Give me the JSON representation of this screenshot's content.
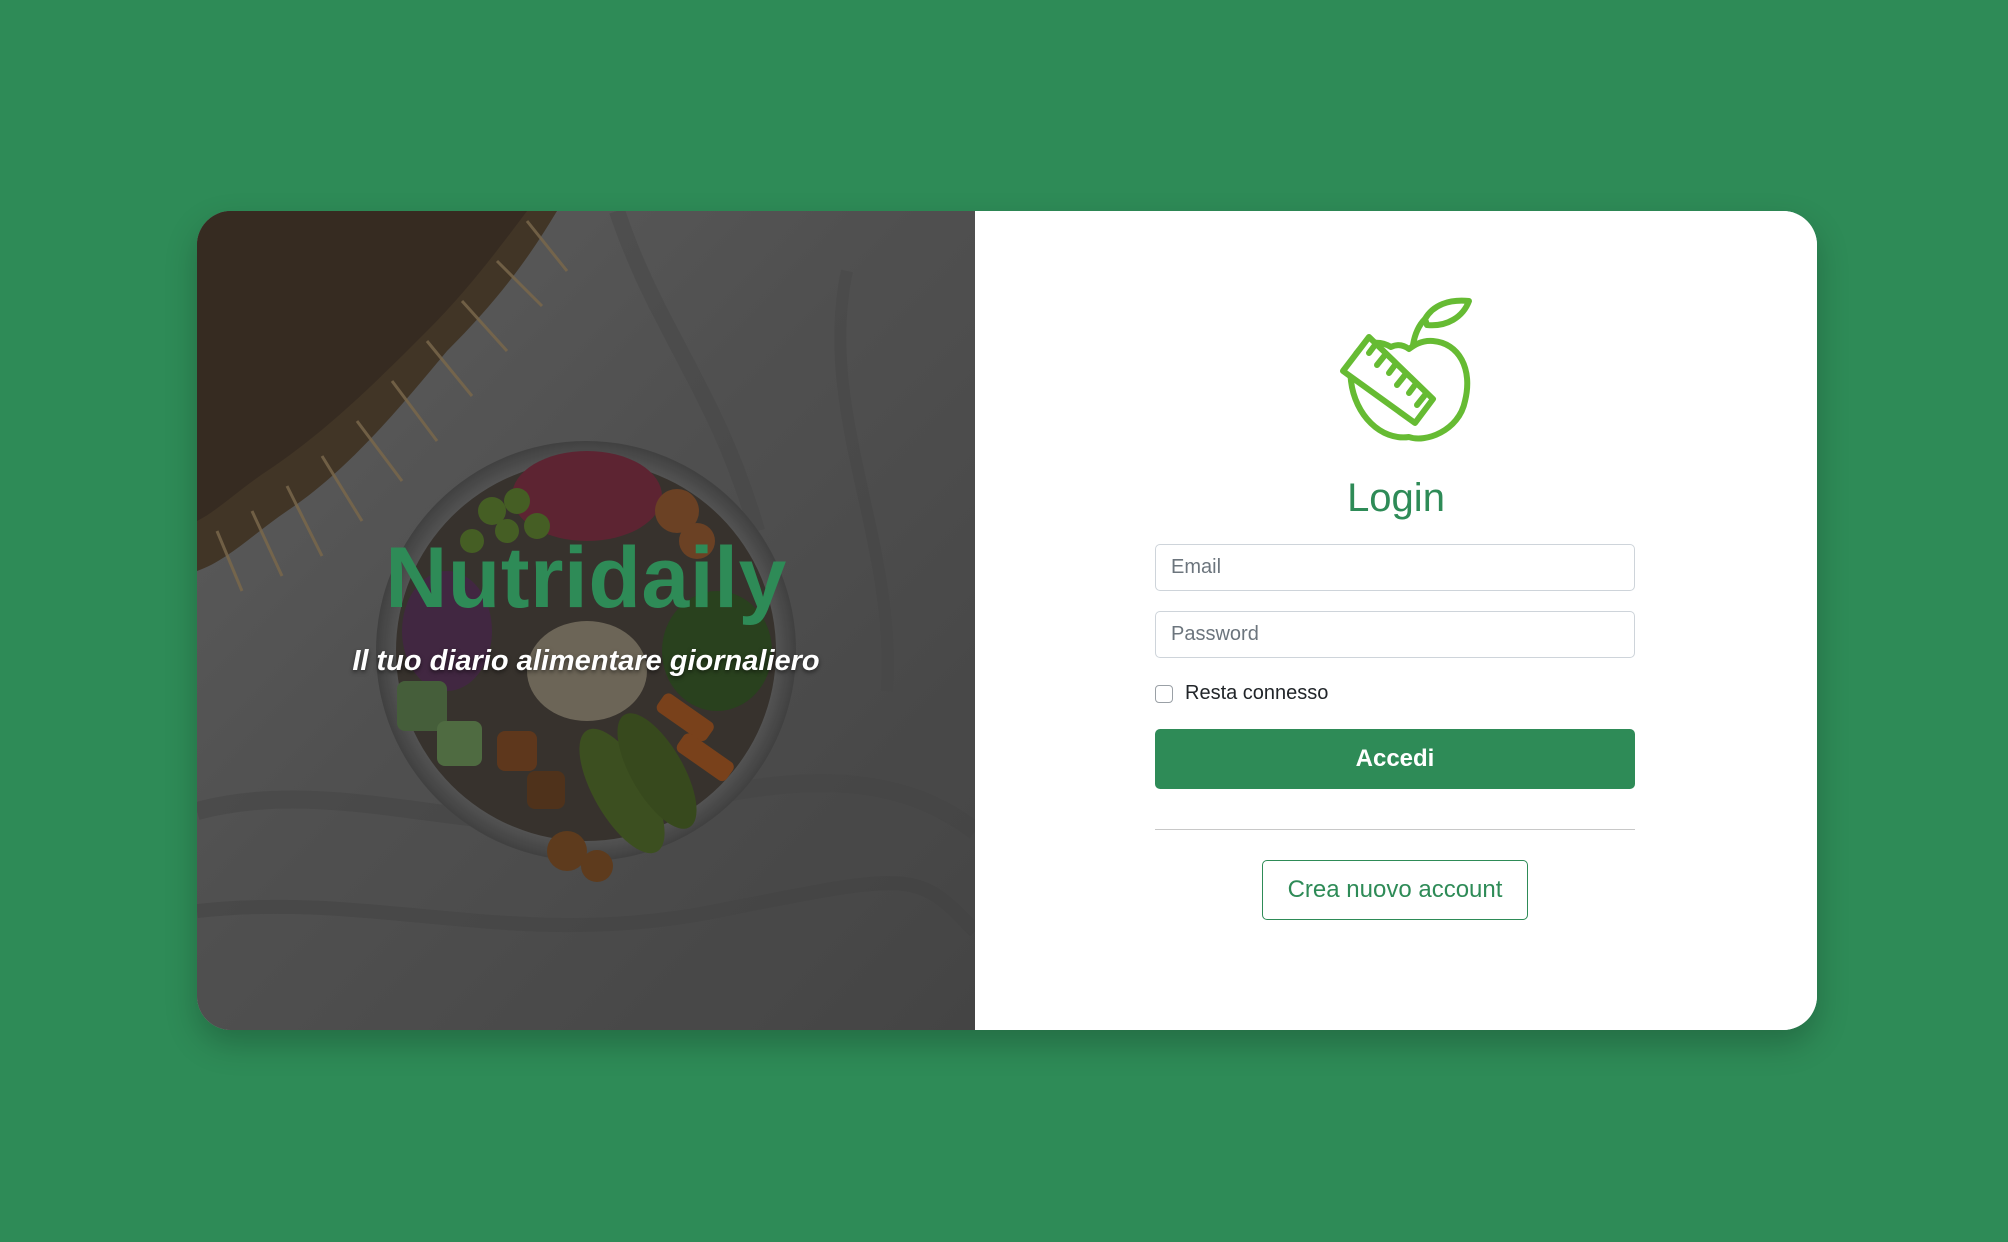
{
  "colors": {
    "page_background": "#2e8b57",
    "brand": "#2e8b57",
    "logo_green": "#66bb33",
    "card_background": "#ffffff"
  },
  "hero": {
    "title": "Nutridaily",
    "subtitle": "Il tuo diario alimentare giornaliero",
    "image_icon": "food-bowl-photo"
  },
  "login": {
    "logo_icon": "apple-measuring-tape-icon",
    "title": "Login",
    "email": {
      "placeholder": "Email",
      "value": ""
    },
    "password": {
      "placeholder": "Password",
      "value": ""
    },
    "remember_me": {
      "label": "Resta connesso",
      "checked": false
    },
    "submit_label": "Accedi",
    "create_account_label": "Crea nuovo account"
  }
}
